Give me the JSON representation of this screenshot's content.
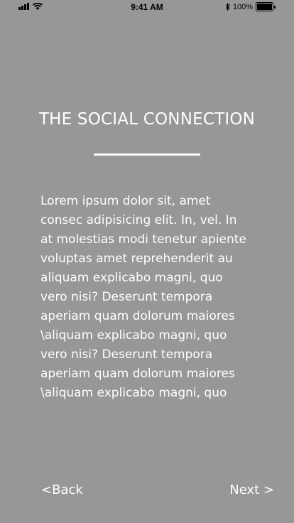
{
  "status_bar": {
    "time": "9:41 AM",
    "battery_text": "100%",
    "icons": [
      "signal-icon",
      "wifi-icon",
      "bluetooth-icon",
      "battery-icon"
    ]
  },
  "screen": {
    "title": "THE SOCIAL CONNECTION",
    "body": "Lorem ipsum dolor sit, amet\nconsec adipisicing elit. In, vel. In\nat molestias modi tenetur apiente\nvoluptas amet reprehenderit au\naliquam explicabo magni, quo\nvero nisi? Deserunt tempora\naperiam quam dolorum maiores\n\\aliquam explicabo magni, quo\nvero nisi? Deserunt tempora\naperiam quam dolorum maiores\n\\aliquam explicabo magni, quo"
  },
  "navigation": {
    "back_label": "<Back",
    "next_label": "Next >"
  },
  "colors": {
    "background": "#979797",
    "text": "#ffffff",
    "status_text": "#000000"
  }
}
